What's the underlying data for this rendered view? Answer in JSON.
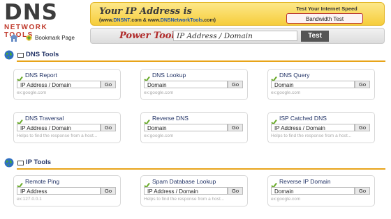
{
  "logo": {
    "big": "DNS",
    "small": "NETWORK TOOLS"
  },
  "top_links": {
    "bookmark": "Bookmark Page"
  },
  "ip_banner": {
    "title": "Your IP Address is",
    "sub_pre": "(www.",
    "sub_b1": "DNSNT",
    "sub_mid": ".com & www.",
    "sub_b2": "DNSNetworkTools",
    "sub_post": ".com)",
    "speed_label": "Test Your Internet Speed",
    "speed_button": "Bandwidth Test"
  },
  "power_tool": {
    "label": "Power Tool",
    "input_value": "IP Address / Domain",
    "button": "Test"
  },
  "colors": {
    "accent_orange": "#e8a419",
    "banner_yellow": "#f6cd3b",
    "link_navy": "#223366",
    "check_green": "#6aab2a"
  },
  "sections": [
    {
      "title": "DNS Tools",
      "cards": [
        {
          "title": "DNS Report",
          "input": "IP Address / Domain",
          "go": "Go",
          "hint": "ex:google.com"
        },
        {
          "title": "DNS Lookup",
          "input": "Domain",
          "go": "Go",
          "hint": "ex:google.com"
        },
        {
          "title": "DNS Query",
          "input": "Domain",
          "go": "Go",
          "hint": "ex:google.com"
        },
        {
          "title": "DNS Traversal",
          "input": "IP Address / Domain",
          "go": "Go",
          "hint": "Helps to find the response from a host..."
        },
        {
          "title": "Reverse DNS",
          "input": "Domain",
          "go": "Go",
          "hint": "ex:google.com"
        },
        {
          "title": "ISP Catched DNS",
          "input": "IP Address / Domain",
          "go": "Go",
          "hint": "Helps to find the response from a host..."
        }
      ]
    },
    {
      "title": "IP Tools",
      "cards": [
        {
          "title": "Remote Ping",
          "input": "IP Address",
          "go": "Go",
          "hint": "ex:127.0.0.1"
        },
        {
          "title": "Spam Database Lookup",
          "input": "IP Address / Domain",
          "go": "Go",
          "hint": "Helps to find the response from a host..."
        },
        {
          "title": "Reverse IP Domain",
          "input": "Domain",
          "go": "Go",
          "hint": "ex:google.com"
        }
      ]
    }
  ]
}
